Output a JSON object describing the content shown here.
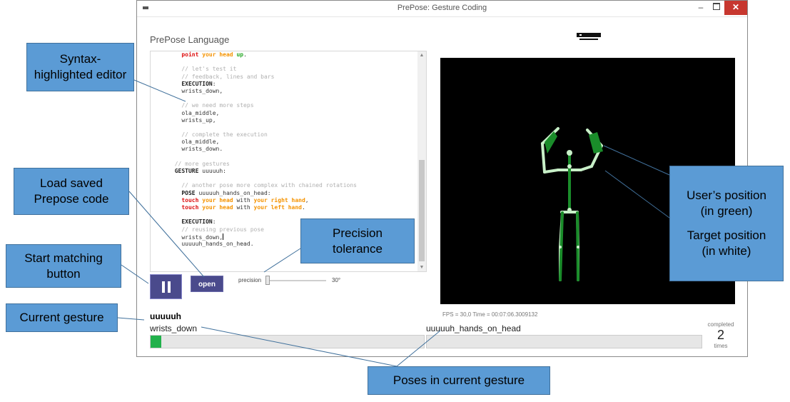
{
  "window": {
    "title": "PrePose: Gesture Coding",
    "minimize_glyph": "–",
    "close_glyph": "✕"
  },
  "editor": {
    "heading": "PrePose Language",
    "lines": [
      [
        [
          "point ",
          "red"
        ],
        [
          "your head",
          "orange"
        ],
        [
          " up",
          "green"
        ],
        [
          ".",
          ""
        ]
      ],
      [
        [
          "",
          ""
        ]
      ],
      [
        [
          "// let's test it",
          "comment"
        ]
      ],
      [
        [
          "// feedback, lines and bars",
          "comment"
        ]
      ],
      [
        [
          "EXECUTION",
          "kw"
        ],
        [
          ":",
          ""
        ]
      ],
      [
        [
          "wrists_down,",
          ""
        ]
      ],
      [
        [
          "",
          ""
        ]
      ],
      [
        [
          "// we need more steps",
          "comment"
        ]
      ],
      [
        [
          "ola_middle,",
          ""
        ]
      ],
      [
        [
          "wrists_up,",
          ""
        ]
      ],
      [
        [
          "",
          ""
        ]
      ],
      [
        [
          "// complete the execution",
          "comment"
        ]
      ],
      [
        [
          "ola_middle,",
          ""
        ]
      ],
      [
        [
          "wrists_down.",
          ""
        ]
      ],
      [
        [
          "",
          ""
        ]
      ],
      [
        [
          "// more gestures",
          "comment"
        ]
      ],
      [
        [
          "GESTURE",
          "kw"
        ],
        [
          " uuuuuh:",
          ""
        ]
      ],
      [
        [
          "",
          ""
        ]
      ],
      [
        [
          "// another pose more complex with chained rotations",
          "comment"
        ]
      ],
      [
        [
          "POSE",
          "kw"
        ],
        [
          " uuuuuh_hands_on_head:",
          ""
        ]
      ],
      [
        [
          "touch ",
          "red"
        ],
        [
          "your head",
          "orange"
        ],
        [
          " with ",
          ""
        ],
        [
          "your right hand",
          "orange"
        ],
        [
          ",",
          ""
        ]
      ],
      [
        [
          "touch ",
          "red"
        ],
        [
          "your head",
          "orange"
        ],
        [
          " with ",
          ""
        ],
        [
          "your left hand",
          "orange"
        ],
        [
          ".",
          ""
        ]
      ],
      [
        [
          "",
          ""
        ]
      ],
      [
        [
          "EXECUTION",
          "kw"
        ],
        [
          ":",
          ""
        ]
      ],
      [
        [
          "// reusing previous pose",
          "comment"
        ]
      ],
      [
        [
          "wrists_down,",
          ""
        ],
        [
          "|CURSOR|",
          ""
        ]
      ],
      [
        [
          "uuuuuh_hands_on_head.",
          ""
        ]
      ]
    ],
    "indents": [
      4,
      0,
      4,
      4,
      4,
      4,
      0,
      4,
      4,
      4,
      0,
      4,
      4,
      4,
      0,
      2,
      2,
      0,
      4,
      4,
      4,
      4,
      0,
      4,
      4,
      4,
      4
    ]
  },
  "controls": {
    "open_label": "open",
    "precision_label": "precision",
    "precision_value": "30°",
    "precision_fraction": 0.0
  },
  "status": {
    "fps_text": "FPS = 30,0 Time = 00:07:06.3009132",
    "gesture_name": "uuuuuh",
    "poses": [
      {
        "name": "wrists_down",
        "progress": 0.04
      },
      {
        "name": "uuuuuh_hands_on_head",
        "progress": 0.0
      }
    ],
    "completed_label": "completed",
    "completed_count": "2",
    "completed_unit": "times"
  },
  "annotations": {
    "syntax_editor": "Syntax-\nhighlighted editor",
    "load_code": "Load saved\nPrepose code",
    "start_matching": "Start matching\nbutton",
    "current_gesture": "Current gesture",
    "precision_tolerance": "Precision\ntolerance",
    "user_position": "User’s position\n(in green)",
    "target_position": "Target position\n(in white)",
    "poses_in_gesture": "Poses in current gesture"
  },
  "colors": {
    "accent_button": "#4a4a8c",
    "callout_fill": "#5b9bd5",
    "user_skeleton": "#1a8c2a",
    "target_skeleton": "#c8f0c8",
    "progress_fill": "#22b14c"
  }
}
